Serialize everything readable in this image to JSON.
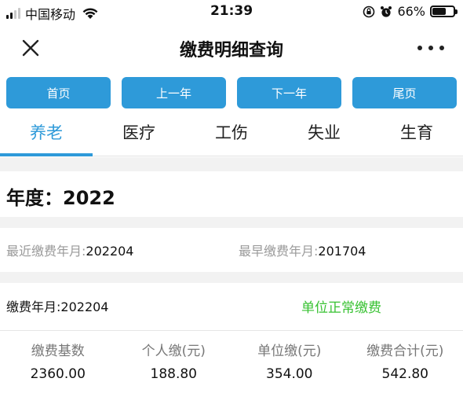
{
  "status_bar": {
    "carrier": "中国移动",
    "time": "21:39",
    "battery_percent": "66%",
    "battery_level": 0.66,
    "icons": [
      "signal-icon",
      "wifi-icon",
      "rotation-lock-icon",
      "alarm-icon",
      "battery-icon"
    ]
  },
  "nav": {
    "title": "缴费明细查询",
    "close_icon": "close-icon",
    "more_icon": "more-icon"
  },
  "pager": {
    "first": "首页",
    "prev_year": "上一年",
    "next_year": "下一年",
    "last": "尾页"
  },
  "tabs": [
    {
      "label": "养老",
      "active": true
    },
    {
      "label": "医疗",
      "active": false
    },
    {
      "label": "工伤",
      "active": false
    },
    {
      "label": "失业",
      "active": false
    },
    {
      "label": "生育",
      "active": false
    }
  ],
  "year": {
    "label": "年度：",
    "value": "2022"
  },
  "months": {
    "latest_label": "最近缴费年月:",
    "latest_value": "202204",
    "earliest_label": "最早缴费年月:",
    "earliest_value": "201704"
  },
  "record": {
    "month_label": "缴费年月:",
    "month_value": "202204",
    "status": "单位正常缴费",
    "headers": [
      "缴费基数",
      "个人缴(元)",
      "单位缴(元)",
      "缴费合计(元)"
    ],
    "values": [
      "2360.00",
      "188.80",
      "354.00",
      "542.80"
    ]
  },
  "colors": {
    "accent": "#2e9ad9",
    "status_green": "#38c232",
    "section_gap": "#f2f2f2"
  }
}
